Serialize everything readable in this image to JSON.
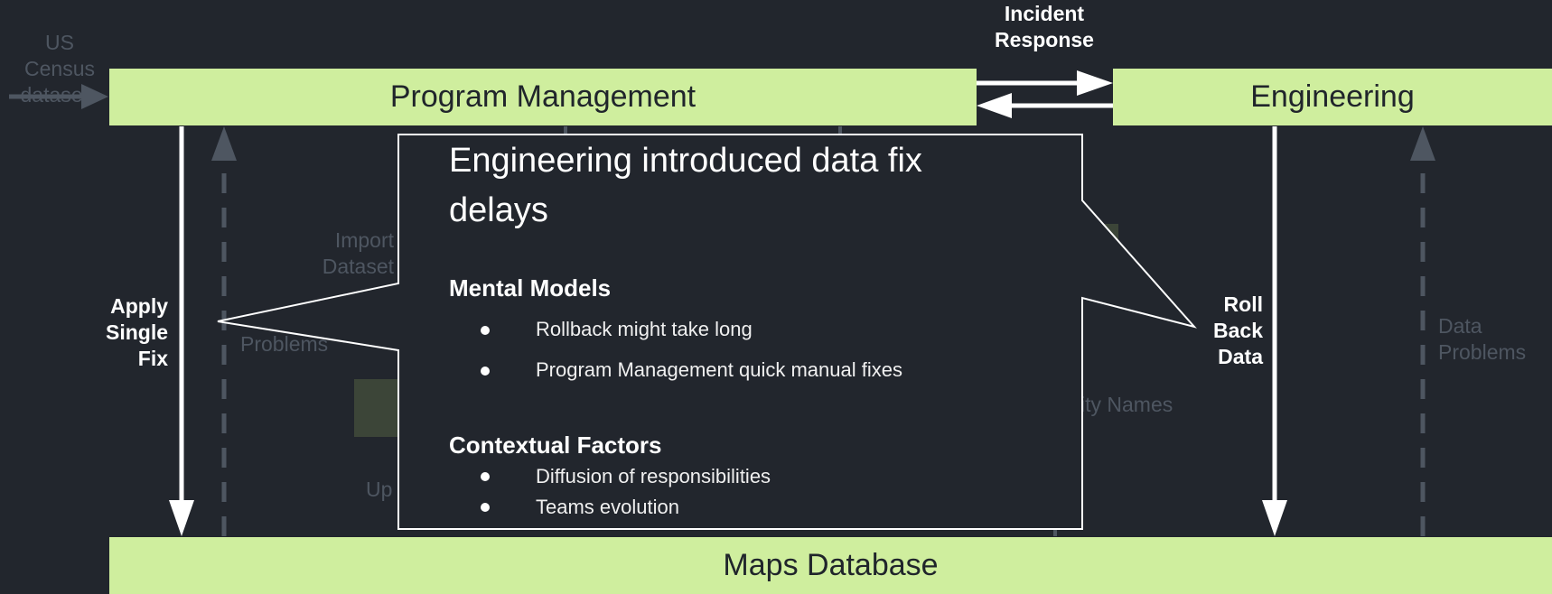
{
  "boxes": {
    "program_management": "Program Management",
    "engineering": "Engineering",
    "maps_database": "Maps Database"
  },
  "labels": {
    "incident_response_line1": "Incident",
    "incident_response_line2": "Response",
    "apply_fix_line1": "Apply",
    "apply_fix_line2": "Single",
    "apply_fix_line3": "Fix",
    "roll_back_line1": "Roll",
    "roll_back_line2": "Back",
    "roll_back_line3": "Data"
  },
  "background_labels": {
    "us_census_line1": "US Census",
    "us_census_line2": "datasets",
    "import_line1": "Import",
    "import_line2": "Dataset",
    "problems": "Problems",
    "update_partial": "Up",
    "city_names_partial": "ity Names",
    "data_problems_line1": "Data",
    "data_problems_line2": "Problems"
  },
  "callout": {
    "title_line1": "Engineering introduced data fix",
    "title_line2": "delays",
    "mental_models_heading": "Mental Models",
    "mental_models_items": [
      "Rollback might take long",
      "Program Management quick manual fixes"
    ],
    "contextual_factors_heading": "Contextual Factors",
    "contextual_factors_items": [
      "Diffusion of responsibilities",
      "Teams evolution"
    ]
  },
  "colors": {
    "background": "#22262d",
    "box_fill": "#cfee9e",
    "box_text": "#20252b",
    "arrow": "#ffffff",
    "dim_element": "#4e5661"
  }
}
